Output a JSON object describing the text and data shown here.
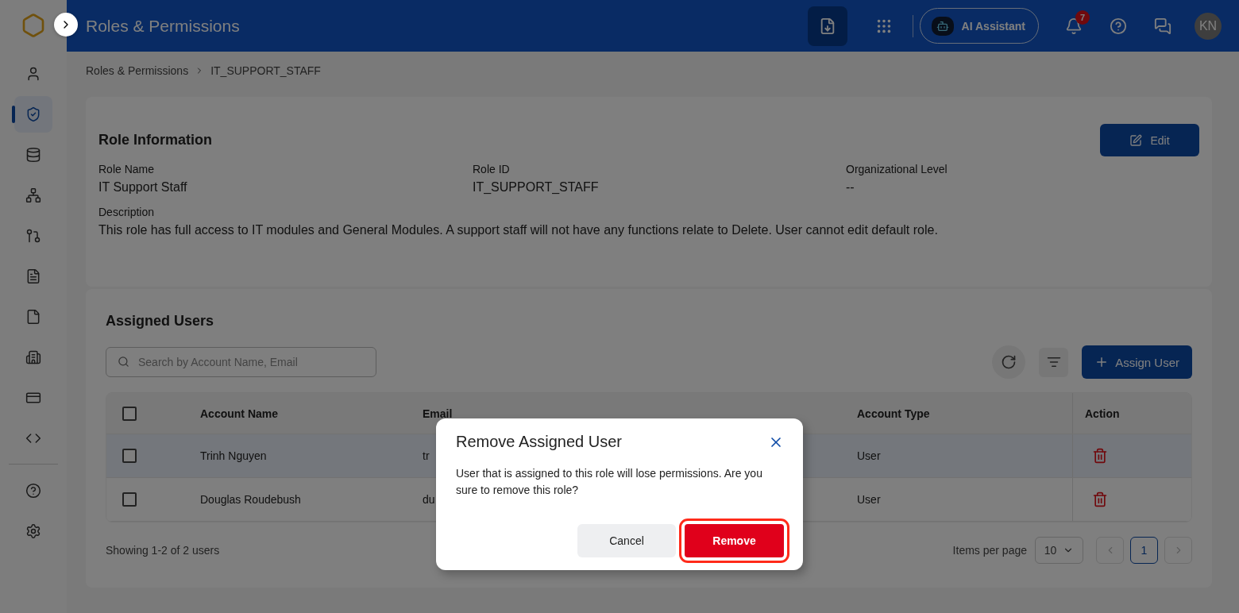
{
  "header": {
    "title": "Roles & Permissions",
    "ai_assistant": "AI Assistant",
    "notification_count": "7",
    "avatar": "KN"
  },
  "sidebar": {
    "items": [
      {
        "selected": false
      },
      {
        "selected": true
      },
      {
        "selected": false
      },
      {
        "selected": false
      },
      {
        "selected": false
      },
      {
        "selected": false
      },
      {
        "selected": false
      },
      {
        "selected": false
      },
      {
        "selected": false
      },
      {
        "selected": false
      }
    ],
    "bottom_items": [
      {
        "selected": false
      },
      {
        "selected": false
      }
    ]
  },
  "breadcrumb": [
    "Roles & Permissions",
    "IT_SUPPORT_STAFF"
  ],
  "role_info": {
    "title": "Role Information",
    "edit_button": "Edit",
    "fields": [
      {
        "label": "Role Name",
        "value": "IT Support Staff"
      },
      {
        "label": "Role ID",
        "value": "IT_SUPPORT_STAFF"
      },
      {
        "label": "Organizational Level",
        "value": "--"
      }
    ],
    "description": {
      "label": "Description",
      "value": "This role has full access to IT modules and General Modules. A support staff will not have any functions relate to Delete. User cannot edit default role."
    }
  },
  "assigned_users": {
    "title": "Assigned Users",
    "search_placeholder": "Search by Account Name, Email",
    "assign_button": "Assign User",
    "select_all_checked": false,
    "columns": [
      "Account Name",
      "Email",
      "Account Type",
      "Action"
    ],
    "rows": [
      {
        "checked": false,
        "selected": true,
        "account_name": "Trinh Nguyen",
        "email": "tr",
        "account_type": "User"
      },
      {
        "checked": false,
        "selected": false,
        "account_name": "Douglas Roudebush",
        "email": "du",
        "account_type": "User"
      }
    ],
    "showing": "Showing 1-2 of 2 users",
    "items_per_page_label": "Items per page",
    "items_per_page": "10",
    "pages": [
      {
        "label": "1",
        "selected": true
      }
    ]
  },
  "dialog": {
    "title": "Remove Assigned User",
    "message": "User that is assigned to this role will lose permissions. Are you sure to remove this role?",
    "cancel": "Cancel",
    "confirm": "Remove",
    "confirm_highlighted": true
  }
}
